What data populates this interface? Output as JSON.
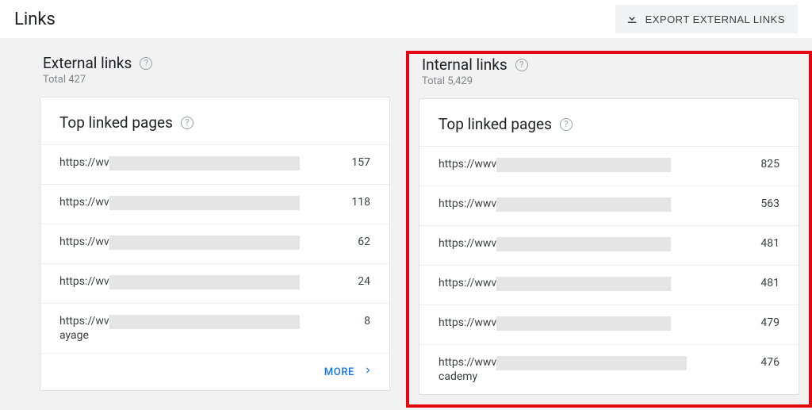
{
  "header": {
    "title": "Links",
    "export_label": "EXPORT EXTERNAL LINKS"
  },
  "external": {
    "title": "External links",
    "total_label": "Total 427",
    "card_title": "Top linked pages",
    "more_label": "MORE",
    "rows": [
      {
        "url_prefix": "https://wv",
        "url_suffix": "",
        "redact_w": 240,
        "count": "157"
      },
      {
        "url_prefix": "https://wv",
        "url_suffix": "",
        "redact_w": 240,
        "count": "118"
      },
      {
        "url_prefix": "https://wv",
        "url_suffix": "",
        "redact_w": 240,
        "count": "62"
      },
      {
        "url_prefix": "https://wv",
        "url_suffix": "",
        "redact_w": 240,
        "count": "24"
      },
      {
        "url_prefix": "https://wv",
        "url_suffix": "ayage",
        "redact_w": 240,
        "count": "8"
      }
    ]
  },
  "internal": {
    "title": "Internal links",
    "total_label": "Total 5,429",
    "card_title": "Top linked pages",
    "rows": [
      {
        "url_prefix": "https://wwv",
        "url_suffix": "",
        "redact_w": 220,
        "count": "825"
      },
      {
        "url_prefix": "https://wwv",
        "url_suffix": "",
        "redact_w": 220,
        "count": "563"
      },
      {
        "url_prefix": "https://wwv",
        "url_suffix": "",
        "redact_w": 220,
        "count": "481"
      },
      {
        "url_prefix": "https://wwv",
        "url_suffix": "",
        "redact_w": 220,
        "count": "481"
      },
      {
        "url_prefix": "https://wwv",
        "url_suffix": "",
        "redact_w": 220,
        "count": "479"
      },
      {
        "url_prefix": "https://wwv",
        "url_suffix": "cademy",
        "redact_w": 240,
        "count": "476"
      }
    ]
  }
}
